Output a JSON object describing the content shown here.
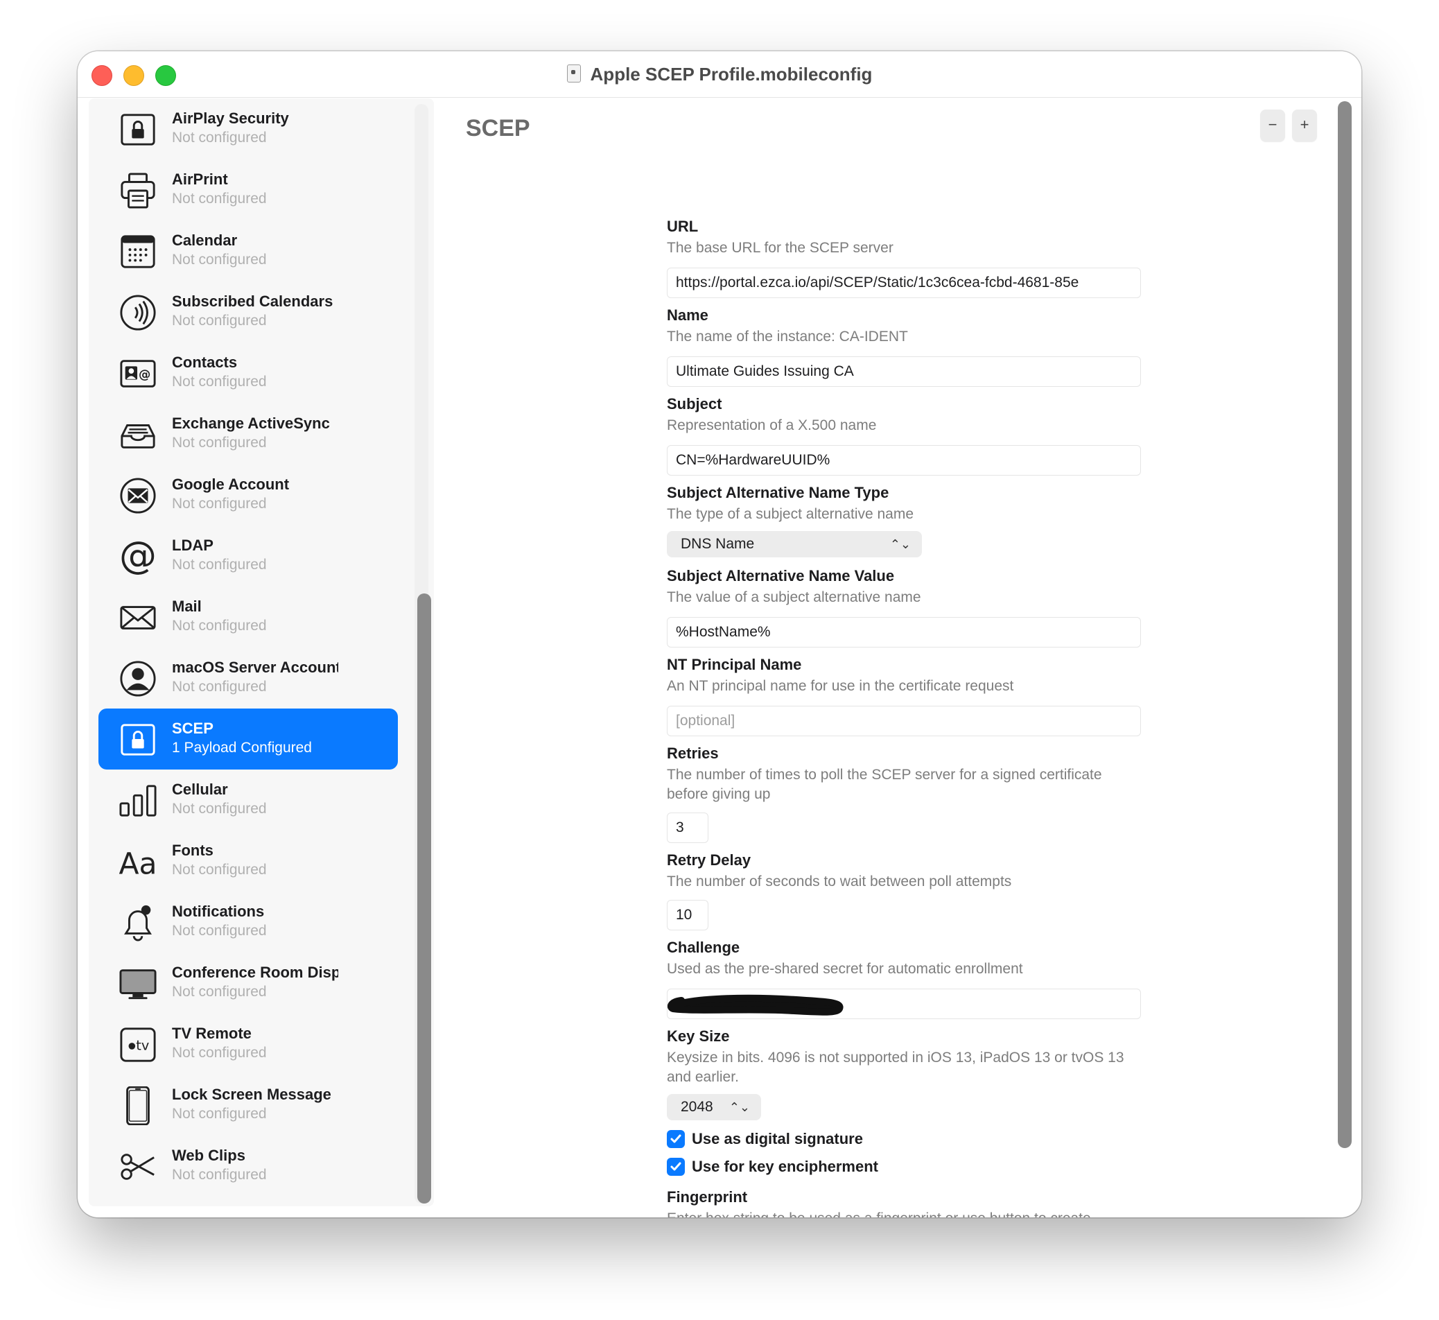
{
  "window": {
    "title": "Apple SCEP Profile.mobileconfig"
  },
  "sidebar": {
    "items": [
      {
        "title": "AirPlay Security",
        "subtitle": "Not configured",
        "icon": "lock-icon"
      },
      {
        "title": "AirPrint",
        "subtitle": "Not configured",
        "icon": "printer-icon"
      },
      {
        "title": "Calendar",
        "subtitle": "Not configured",
        "icon": "calendar-icon"
      },
      {
        "title": "Subscribed Calendars",
        "subtitle": "Not configured",
        "icon": "broadcast-icon"
      },
      {
        "title": "Contacts",
        "subtitle": "Not configured",
        "icon": "contact-card-icon"
      },
      {
        "title": "Exchange ActiveSync",
        "subtitle": "Not configured",
        "icon": "tray-icon"
      },
      {
        "title": "Google Account",
        "subtitle": "Not configured",
        "icon": "envelope-circle-icon"
      },
      {
        "title": "LDAP",
        "subtitle": "Not configured",
        "icon": "at-sign-icon"
      },
      {
        "title": "Mail",
        "subtitle": "Not configured",
        "icon": "envelope-icon"
      },
      {
        "title": "macOS Server Account",
        "subtitle": "Not configured",
        "icon": "person-circle-icon"
      },
      {
        "title": "SCEP",
        "subtitle": "1 Payload Configured",
        "icon": "lock-icon",
        "selected": true
      },
      {
        "title": "Cellular",
        "subtitle": "Not configured",
        "icon": "signal-bars-icon"
      },
      {
        "title": "Fonts",
        "subtitle": "Not configured",
        "icon": "font-icon"
      },
      {
        "title": "Notifications",
        "subtitle": "Not configured",
        "icon": "bell-icon"
      },
      {
        "title": "Conference Room Display",
        "subtitle": "Not configured",
        "icon": "display-icon"
      },
      {
        "title": "TV Remote",
        "subtitle": "Not configured",
        "icon": "apple-tv-icon"
      },
      {
        "title": "Lock Screen Message",
        "subtitle": "Not configured",
        "icon": "phone-icon"
      },
      {
        "title": "Web Clips",
        "subtitle": "Not configured",
        "icon": "scissors-icon"
      }
    ]
  },
  "main": {
    "section_title": "SCEP",
    "remove_label": "−",
    "add_label": "+",
    "fields": {
      "url": {
        "label": "URL",
        "description": "The base URL for the SCEP server",
        "value": "https://portal.ezca.io/api/SCEP/Static/1c3c6cea-fcbd-4681-85e"
      },
      "name": {
        "label": "Name",
        "description": "The name of the instance: CA-IDENT",
        "value": "Ultimate Guides Issuing CA"
      },
      "subject": {
        "label": "Subject",
        "description": "Representation of a X.500 name",
        "value": "CN=%HardwareUUID%"
      },
      "san_type": {
        "label": "Subject Alternative Name Type",
        "description": "The type of a subject alternative name",
        "value": "DNS Name"
      },
      "san_value": {
        "label": "Subject Alternative Name Value",
        "description": "The value of a subject alternative name",
        "value": "%HostName%"
      },
      "nt_principal": {
        "label": "NT Principal Name",
        "description": "An NT principal name for use in the certificate request",
        "placeholder": "[optional]"
      },
      "retries": {
        "label": "Retries",
        "description": "The number of times to poll the SCEP server for a signed certificate before giving up",
        "value": "3"
      },
      "retry_delay": {
        "label": "Retry Delay",
        "description": "The number of seconds to wait between poll attempts",
        "value": "10"
      },
      "challenge": {
        "label": "Challenge",
        "description": "Used as the pre-shared secret for automatic enrollment"
      },
      "key_size": {
        "label": "Key Size",
        "description": "Keysize in bits. 4096 is not supported in iOS 13, iPadOS 13 or tvOS 13 and earlier.",
        "value": "2048"
      },
      "digital_signature": {
        "label": "Use as digital signature",
        "checked": true
      },
      "key_encipherment": {
        "label": "Use for key encipherment",
        "checked": true
      },
      "fingerprint": {
        "label": "Fingerprint",
        "description": "Enter hex string to be used as a fingerprint or use button to create fingerprint from Certificate"
      }
    }
  },
  "colors": {
    "accent": "#0a7aff",
    "subtitle": "#b0b0b0",
    "description": "#7d7d7d"
  }
}
